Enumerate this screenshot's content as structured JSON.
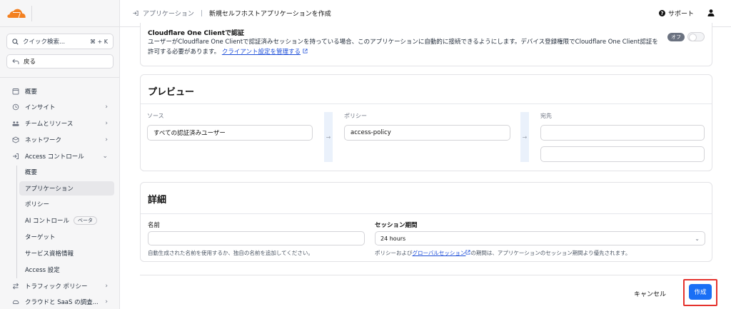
{
  "sidebar": {
    "search_placeholder": "クイック検索...",
    "search_shortcut": "⌘ + K",
    "back_label": "戻る",
    "items": [
      {
        "label": "概要"
      },
      {
        "label": "インサイト"
      },
      {
        "label": "チームとリソース"
      },
      {
        "label": "ネットワーク"
      },
      {
        "label": "Access コントロール"
      }
    ],
    "sub_items": [
      {
        "label": "概要"
      },
      {
        "label": "アプリケーション"
      },
      {
        "label": "ポリシー"
      },
      {
        "label": "AI コントロール",
        "badge": "ベータ"
      },
      {
        "label": "ターゲット"
      },
      {
        "label": "サービス資格情報"
      },
      {
        "label": "Access 設定"
      }
    ],
    "bottom_items": [
      {
        "label": "トラフィック ポリシー"
      },
      {
        "label": "クラウドと SaaS の調査..."
      }
    ]
  },
  "header": {
    "breadcrumb_parent": "アプリケーション",
    "breadcrumb_current": "新規セルフホストアプリケーションを作成",
    "support_label": "サポート"
  },
  "one_client": {
    "title": "Cloudflare One Clientで認証",
    "desc": "ユーザーがCloudflare One Clientで認証済みセッションを持っている場合、このアプリケーションに自動的に接続できるようにします。デバイス登録権限でCloudflare One Client認証を許可する必要があります。",
    "link": "クライアント設定を管理する",
    "toggle_state": "オフ"
  },
  "preview": {
    "title": "プレビュー",
    "source_label": "ソース",
    "source_value": "すべての認証済みユーザー",
    "policy_label": "ポリシー",
    "policy_value": "access-policy",
    "dest_label": "宛先"
  },
  "details": {
    "title": "詳細",
    "name_label": "名前",
    "name_help": "自動生成された名前を使用するか、独自の名前を追加してください。",
    "session_label": "セッション期間",
    "session_value": "24 hours",
    "session_help_pre": "ポリシーおよび",
    "session_help_link": "グローバルセッション",
    "session_help_post": "の期間は、アプリケーションのセッション期間より優先されます。"
  },
  "footer": {
    "cancel_label": "キャンセル",
    "create_label": "作成"
  },
  "colors": {
    "brand_orange": "#f38020",
    "primary_blue": "#1a6ff5",
    "highlight_red": "#e5322d"
  }
}
